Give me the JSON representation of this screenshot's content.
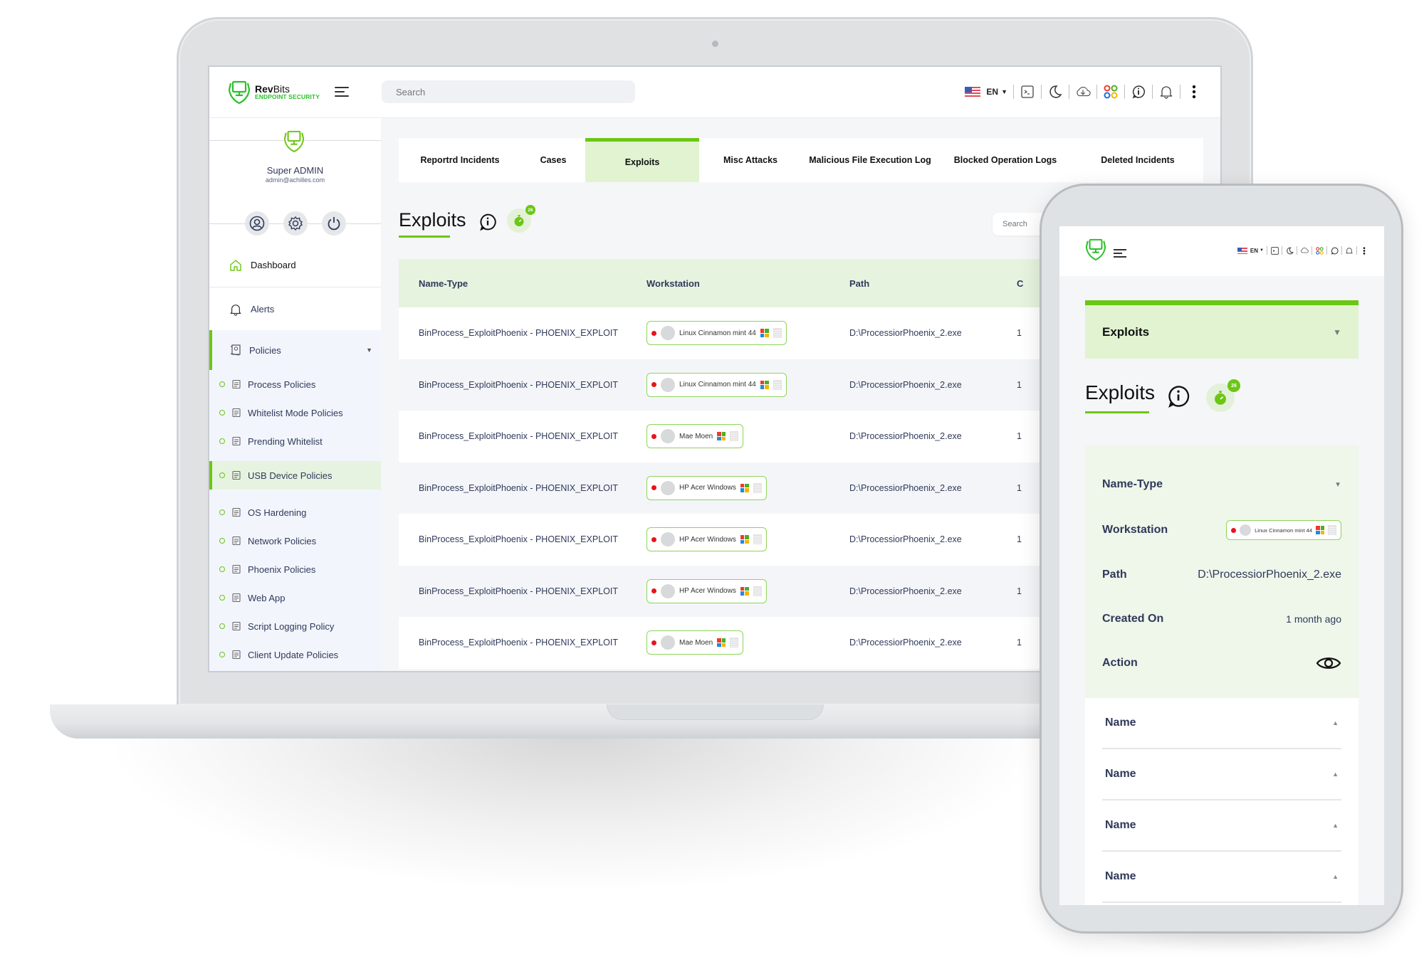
{
  "app": {
    "brand_name_bold": "Rev",
    "brand_name_light": "Bits",
    "brand_tagline": "ENDPOINT SECURITY"
  },
  "header": {
    "search_placeholder": "Search",
    "language": "EN",
    "icons": [
      "us-flag-icon",
      "terminal-icon",
      "moon-icon",
      "cloud-download-icon",
      "apps-grid-icon",
      "info-chat-icon",
      "bell-icon",
      "more-vertical-icon"
    ]
  },
  "profile": {
    "name": "Super ADMIN",
    "email": "admin@achilles.com"
  },
  "sidebar": {
    "dashboard": "Dashboard",
    "alerts": "Alerts",
    "policies": "Policies",
    "policy_items": [
      {
        "label": "Process Policies",
        "icon": "process-doc-icon"
      },
      {
        "label": "Whitelist Mode Policies",
        "icon": "whitelist-doc-icon"
      },
      {
        "label": "Prending Whitelist",
        "icon": "document-icon"
      },
      {
        "label": "USB Device Policies",
        "icon": "usb-icon",
        "active": true
      },
      {
        "label": "OS Hardening",
        "icon": "code-window-icon"
      },
      {
        "label": "Network Policies",
        "icon": "network-globe-icon"
      },
      {
        "label": "Phoenix Policies",
        "icon": "phoenix-icon"
      },
      {
        "label": "Web App",
        "icon": "web-globe-icon"
      },
      {
        "label": "Script Logging Policy",
        "icon": "script-file-icon"
      },
      {
        "label": "Client Update Policies",
        "icon": "update-window-icon"
      }
    ]
  },
  "tabs": [
    {
      "label": "Reportrd Incidents"
    },
    {
      "label": "Cases"
    },
    {
      "label": "Exploits",
      "active": true
    },
    {
      "label": "Misc Attacks"
    },
    {
      "label": "Malicious File Execution Log"
    },
    {
      "label": "Blocked Operation Logs"
    },
    {
      "label": "Deleted Incidents"
    }
  ],
  "page": {
    "title": "Exploits",
    "timer_badge": "26",
    "search_placeholder": "Search"
  },
  "table": {
    "columns": [
      "Name-Type",
      "Workstation",
      "Path",
      "C"
    ],
    "rows": [
      {
        "name_type": "BinProcess_ExploitPhoenix - PHOENIX_EXPLOIT",
        "workstation": "Linux Cinnamon mint 44",
        "path": "D:\\ProcessiorPhoenix_2.exe",
        "created": "1"
      },
      {
        "name_type": "BinProcess_ExploitPhoenix - PHOENIX_EXPLOIT",
        "workstation": "Linux Cinnamon mint 44",
        "path": "D:\\ProcessiorPhoenix_2.exe",
        "created": "1"
      },
      {
        "name_type": "BinProcess_ExploitPhoenix - PHOENIX_EXPLOIT",
        "workstation": "Mae Moen",
        "path": "D:\\ProcessiorPhoenix_2.exe",
        "created": "1"
      },
      {
        "name_type": "BinProcess_ExploitPhoenix - PHOENIX_EXPLOIT",
        "workstation": "HP Acer Windows",
        "path": "D:\\ProcessiorPhoenix_2.exe",
        "created": "1"
      },
      {
        "name_type": "BinProcess_ExploitPhoenix - PHOENIX_EXPLOIT",
        "workstation": "HP Acer Windows",
        "path": "D:\\ProcessiorPhoenix_2.exe",
        "created": "1"
      },
      {
        "name_type": "BinProcess_ExploitPhoenix - PHOENIX_EXPLOIT",
        "workstation": "HP Acer Windows",
        "path": "D:\\ProcessiorPhoenix_2.exe",
        "created": "1"
      },
      {
        "name_type": "BinProcess_ExploitPhoenix - PHOENIX_EXPLOIT",
        "workstation": "Mae Moen",
        "path": "D:\\ProcessiorPhoenix_2.exe",
        "created": "1"
      }
    ]
  },
  "mobile": {
    "language": "EN",
    "dropdown_label": "Exploits",
    "title": "Exploits",
    "timer_badge": "26",
    "card": {
      "name_type_label": "Name-Type",
      "workstation_label": "Workstation",
      "workstation_value": "Linux Cinnamon mint 44",
      "path_label": "Path",
      "path_value": "D:\\ProcessiorPhoenix_2.exe",
      "created_label": "Created On",
      "created_value": "1 month ago",
      "action_label": "Action"
    },
    "list_items": [
      "Name",
      "Name",
      "Name",
      "Name"
    ]
  },
  "colors": {
    "accent_green": "#6cc614",
    "brand_green": "#2bc02b",
    "status_red": "#e8131b",
    "tab_active_bg": "#e1f3d1",
    "text_navy": "#2f3a5a"
  }
}
